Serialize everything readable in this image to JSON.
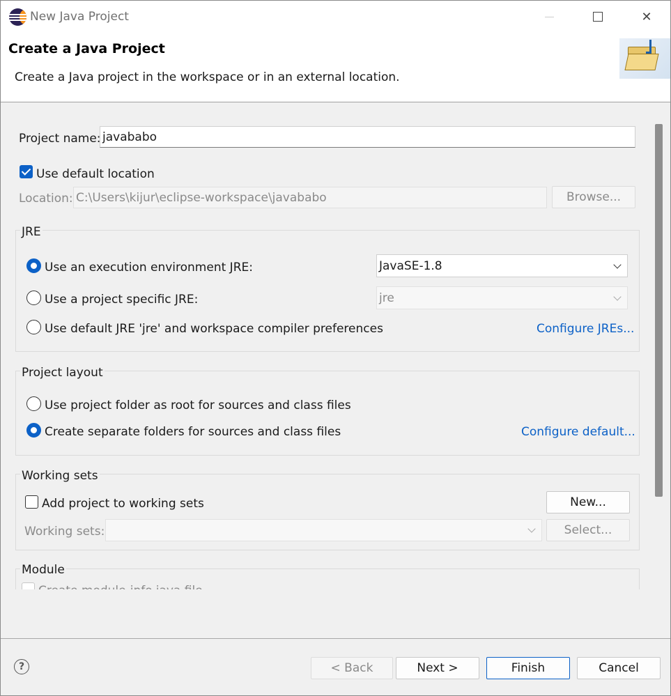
{
  "window": {
    "title": "New Java Project",
    "minimize_label": "",
    "maximize_label": "",
    "close_label": "✕"
  },
  "banner": {
    "title": "Create a Java Project",
    "description": "Create a Java project in the workspace or in an external location."
  },
  "project": {
    "name_label": "Project name:",
    "name_value": "javababo",
    "use_default_location_label": "Use default location",
    "use_default_location_checked": true,
    "location_label": "Location:",
    "location_value": "C:\\Users\\kijur\\eclipse-workspace\\javababo",
    "browse_label": "Browse..."
  },
  "jre": {
    "group_title": "JRE",
    "option_env_label": "Use an execution environment JRE:",
    "option_env_value": "JavaSE-1.8",
    "option_specific_label": "Use a project specific JRE:",
    "option_specific_value": "jre",
    "option_default_label": "Use default JRE 'jre' and workspace compiler preferences",
    "configure_link": "Configure JREs..."
  },
  "layout": {
    "group_title": "Project layout",
    "option_root_label": "Use project folder as root for sources and class files",
    "option_separate_label": "Create separate folders for sources and class files",
    "configure_link": "Configure default..."
  },
  "working_sets": {
    "group_title": "Working sets",
    "add_label": "Add project to working sets",
    "new_button": "New...",
    "sets_label": "Working sets:",
    "sets_value": "",
    "select_button": "Select..."
  },
  "module": {
    "group_title": "Module",
    "create_label": "Create module-info.java file"
  },
  "footer": {
    "help_symbol": "?",
    "back_button": "< Back",
    "next_button": "Next >",
    "finish_button": "Finish",
    "cancel_button": "Cancel"
  },
  "colors": {
    "accent": "#0c61c7",
    "disabled_text": "#8a8a8a",
    "background": "#f0f0f0"
  }
}
